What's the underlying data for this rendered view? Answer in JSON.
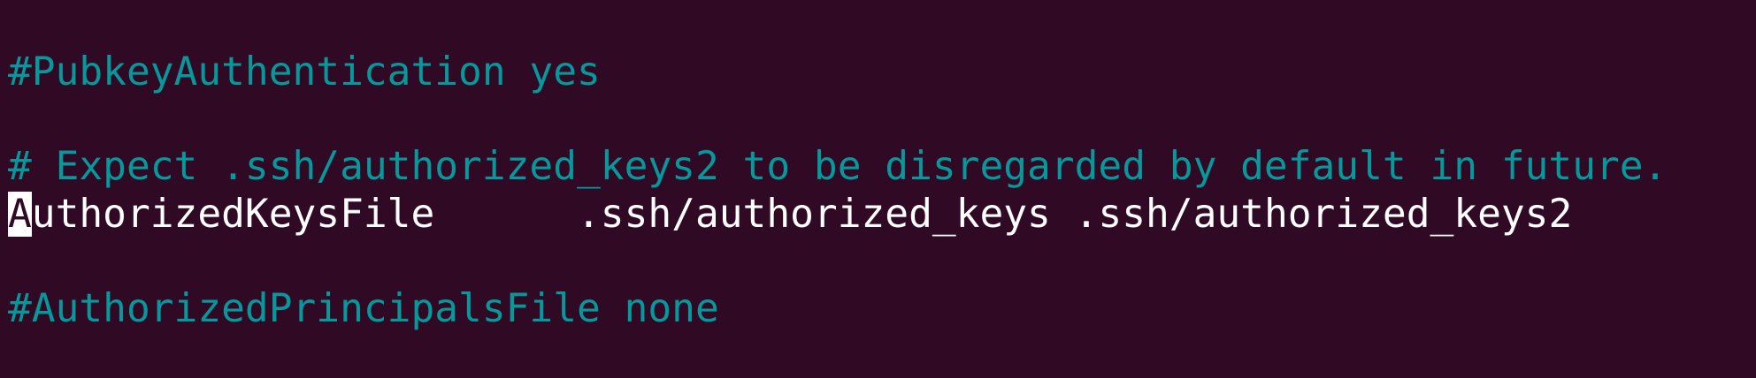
{
  "terminal": {
    "background": "#300a24",
    "comment_color": "#06989a",
    "text_color": "#ffffff",
    "lines": [
      {
        "type": "comment",
        "text": "#PubkeyAuthentication yes"
      },
      {
        "type": "blank",
        "text": ""
      },
      {
        "type": "comment",
        "text": "# Expect .ssh/authorized_keys2 to be disregarded by default in future."
      },
      {
        "type": "cursor-line",
        "cursor_char": "A",
        "rest": "uthorizedKeysFile      .ssh/authorized_keys .ssh/authorized_keys2"
      },
      {
        "type": "blank",
        "text": ""
      },
      {
        "type": "comment",
        "text": "#AuthorizedPrincipalsFile none"
      }
    ]
  }
}
